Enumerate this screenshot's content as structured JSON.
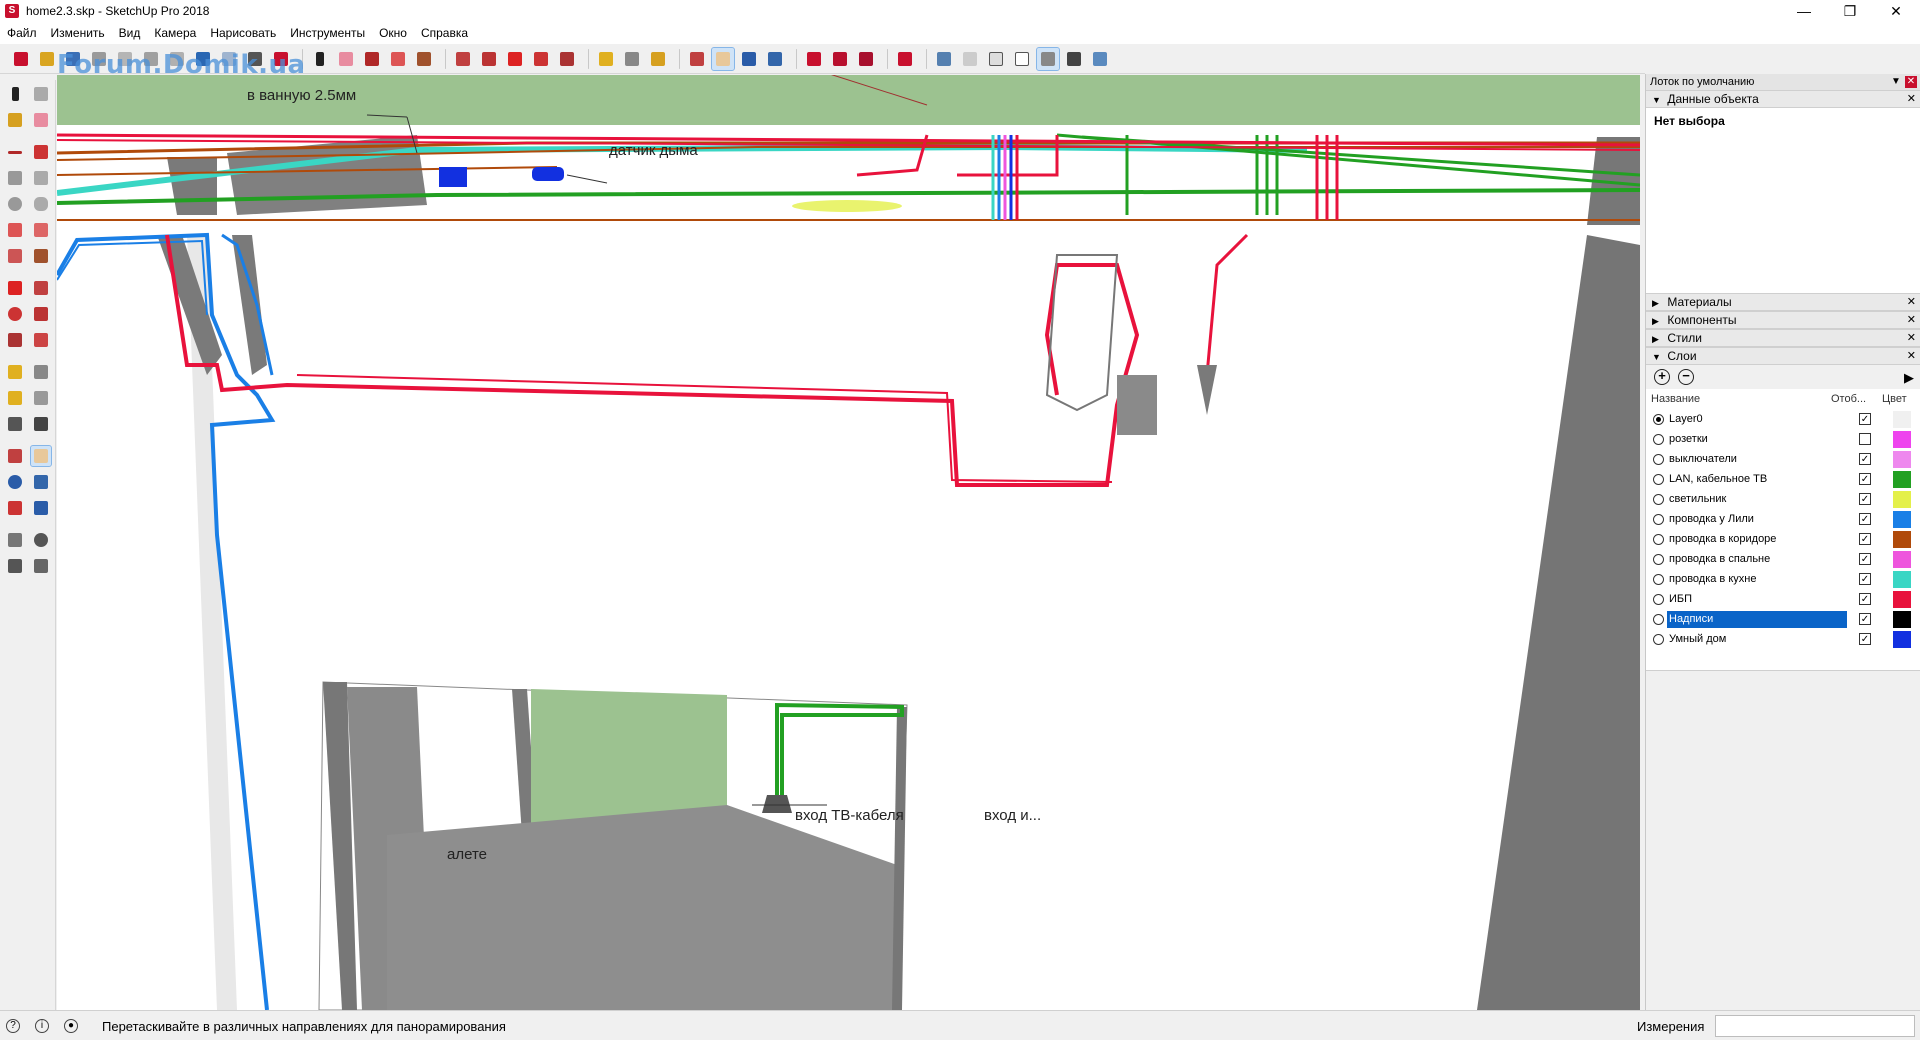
{
  "window": {
    "title": "home2.3.skp - SketchUp Pro 2018",
    "app_icon": "sketchup-icon",
    "controls": [
      "minimize",
      "restore",
      "close"
    ]
  },
  "menu": [
    "Файл",
    "Изменить",
    "Вид",
    "Камера",
    "Нарисовать",
    "Инструменты",
    "Окно",
    "Справка"
  ],
  "watermark": "Forum.Domik.ua",
  "viewport": {
    "labels": {
      "bath": "в ванную 2.5мм",
      "smoke": "датчик дыма",
      "tv_cable": "вход ТВ-кабеля",
      "entry2": "вход и...",
      "toilet": "алете"
    }
  },
  "tray": {
    "title": "Лоток по умолчанию",
    "entity_info": {
      "label": "Данные объекта",
      "selection": "Нет выбора"
    },
    "panels": [
      {
        "label": "Материалы",
        "expanded": false
      },
      {
        "label": "Компоненты",
        "expanded": false
      },
      {
        "label": "Стили",
        "expanded": false
      },
      {
        "label": "Слои",
        "expanded": true
      }
    ],
    "layers": {
      "col_name": "Название",
      "col_visible": "Отоб...",
      "col_color": "Цвет",
      "rows": [
        {
          "name": "Layer0",
          "active": true,
          "visible": true,
          "color": "#f0f0f0"
        },
        {
          "name": "розетки",
          "active": false,
          "visible": false,
          "color": "#ee44ee"
        },
        {
          "name": "выключатели",
          "active": false,
          "visible": true,
          "color": "#ee88ee"
        },
        {
          "name": "LAN, кабельное ТВ",
          "active": false,
          "visible": true,
          "color": "#22a022"
        },
        {
          "name": "светильник",
          "active": false,
          "visible": true,
          "color": "#e4f04a"
        },
        {
          "name": "проводка у Лили",
          "active": false,
          "visible": true,
          "color": "#1a7fe6"
        },
        {
          "name": "проводка в коридоре",
          "active": false,
          "visible": true,
          "color": "#b04a0a"
        },
        {
          "name": "проводка в спальне",
          "active": false,
          "visible": true,
          "color": "#ee55dd"
        },
        {
          "name": "проводка в кухне",
          "active": false,
          "visible": true,
          "color": "#3ad6c4"
        },
        {
          "name": "ИБП",
          "active": false,
          "visible": true,
          "color": "#e8123c"
        },
        {
          "name": "Надписи",
          "active": false,
          "visible": true,
          "color": "#000000",
          "selected": true
        },
        {
          "name": "Умный дом",
          "active": false,
          "visible": true,
          "color": "#1230e0"
        }
      ]
    }
  },
  "status": {
    "hint": "Перетаскивайте в различных направлениях для панорамирования",
    "measure_label": "Измерения",
    "measure_value": ""
  }
}
